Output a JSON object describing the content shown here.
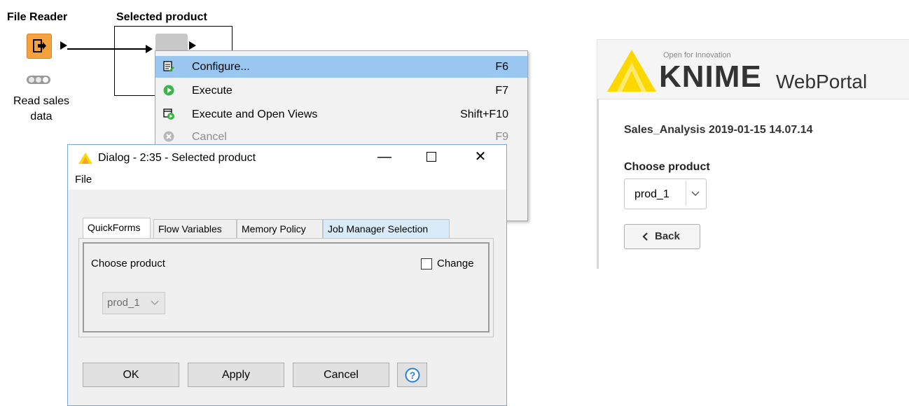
{
  "workflow": {
    "file_reader": {
      "title": "File Reader",
      "caption": "Read sales\ndata"
    },
    "selected_product": {
      "title": "Selected product"
    }
  },
  "context_menu": {
    "items": [
      {
        "label": "Configure...",
        "shortcut": "F6",
        "icon": "configure-icon",
        "state": "highlighted"
      },
      {
        "label": "Execute",
        "shortcut": "F7",
        "icon": "execute-icon",
        "state": "normal"
      },
      {
        "label": "Execute and Open Views",
        "shortcut": "Shift+F10",
        "icon": "execute-open-views-icon",
        "state": "normal"
      },
      {
        "label": "Cancel",
        "shortcut": "F9",
        "icon": "cancel-icon",
        "state": "disabled"
      }
    ]
  },
  "dialog": {
    "title": "Dialog - 2:35 - Selected product",
    "menu": "File",
    "tabs": [
      "QuickForms",
      "Flow Variables",
      "Memory Policy",
      "Job Manager Selection"
    ],
    "active_tab": "QuickForms",
    "field_label": "Choose product",
    "change_label": "Change",
    "change_checked": false,
    "select_value": "prod_1",
    "buttons": {
      "ok": "OK",
      "apply": "Apply",
      "cancel": "Cancel"
    }
  },
  "portal": {
    "tagline": "Open for Innovation",
    "brand": "KNIME",
    "product": "WebPortal",
    "job_title": "Sales_Analysis 2019-01-15 14.07.14",
    "choose_label": "Choose product",
    "select_value": "prod_1",
    "back_label": "Back"
  },
  "colors": {
    "node_orange": "#f5a13d",
    "menu_highlight": "#9ac7f0",
    "knime_yellow": "#fdd800",
    "knime_text": "#333333"
  }
}
